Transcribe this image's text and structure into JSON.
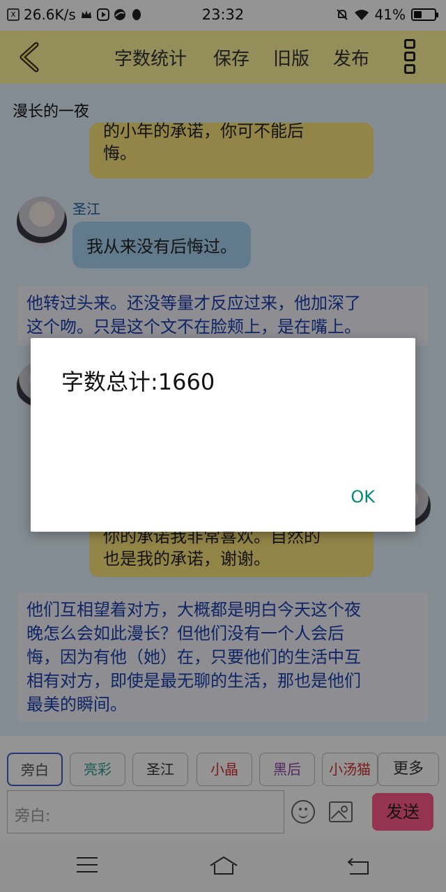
{
  "status_bar": {
    "net_speed": "26.6K/s",
    "time": "23:32",
    "battery": "41%",
    "battery_level": 0.41
  },
  "toolbar": {
    "back_icon": "chevron-left-icon",
    "word_count": "字数统计",
    "save": "保存",
    "old_version": "旧版",
    "publish": "发布",
    "menu_icon": "more-vertical-icon"
  },
  "story": {
    "title": "漫长的一夜",
    "msg1_line1": "的小年的承诺，你可不能后",
    "msg1_line2": "悔。",
    "speaker1": "圣江",
    "msg2": "我从来没有后悔过。",
    "narration1_line1": "他转过头来。还没等量才反应过来，他加深了",
    "narration1_line2": "这个吻。只是这个文不在脸颊上，是在嘴上。",
    "msg3_line1": "你的承诺我非常喜欢。自然的",
    "msg3_line2": "也是我的承诺，谢谢。",
    "narration2_lines": [
      "他们互相望着对方，大概都是明白今天这个夜",
      "晚怎么会如此漫长？但他们没有一个人会后",
      "悔，因为有他（她）在，只要他们的生活中互",
      "相有对方，即使是最无聊的生活，那也是他们",
      "最美的瞬间。"
    ]
  },
  "roles": {
    "narrator": "旁白",
    "liangcai": "亮彩",
    "shengjiang": "圣江",
    "xiaojing": "小晶",
    "heihou": "黑后",
    "xiaotangmao": "小汤猫",
    "more": "更多"
  },
  "input": {
    "placeholder": "旁白:",
    "send": "发送"
  },
  "dialog": {
    "message": "字数总计:1660",
    "ok": "OK"
  },
  "colors": {
    "toolbar": "#fff59d",
    "content_bg": "#e4f2fd",
    "bubble_yellow": "#fde47a",
    "bubble_blue": "#a8d4f3",
    "narration_text": "#1a3fae",
    "send_button": "#ff5a8a",
    "dialog_ok": "#00897b"
  }
}
